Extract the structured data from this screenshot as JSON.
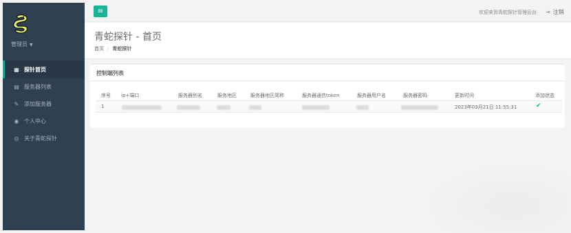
{
  "sidebar": {
    "user": "管理员",
    "items": [
      {
        "label": "探针首页",
        "icon": "grid-icon",
        "active": true
      },
      {
        "label": "服务器列表",
        "icon": "list-icon",
        "active": false
      },
      {
        "label": "添加服务器",
        "icon": "edit-icon",
        "active": false
      },
      {
        "label": "个人中心",
        "icon": "user-circle-icon",
        "active": false
      },
      {
        "label": "关于青蛇探针",
        "icon": "eye-icon",
        "active": false
      }
    ]
  },
  "topbar": {
    "welcome": "欢迎来到青蛇探针管理后台",
    "logout": "注销"
  },
  "heading": {
    "title": "青蛇探针 - 首页",
    "breadcrumb": [
      "首页",
      "青蛇探针"
    ]
  },
  "panel": {
    "title": "控制端列表",
    "columns": [
      "序号",
      "ip+端口",
      "服务器别名",
      "服务地区",
      "服务器地区简称",
      "服务器通信token",
      "服务器用户名",
      "服务器密码",
      "更新时间",
      "添加状态"
    ],
    "rows": [
      {
        "index": "1",
        "updated": "2023年03月21日 11:55:31",
        "status": "ok"
      }
    ]
  },
  "colors": {
    "sidebar_bg": "#2f4050",
    "accent": "#1ab394"
  }
}
